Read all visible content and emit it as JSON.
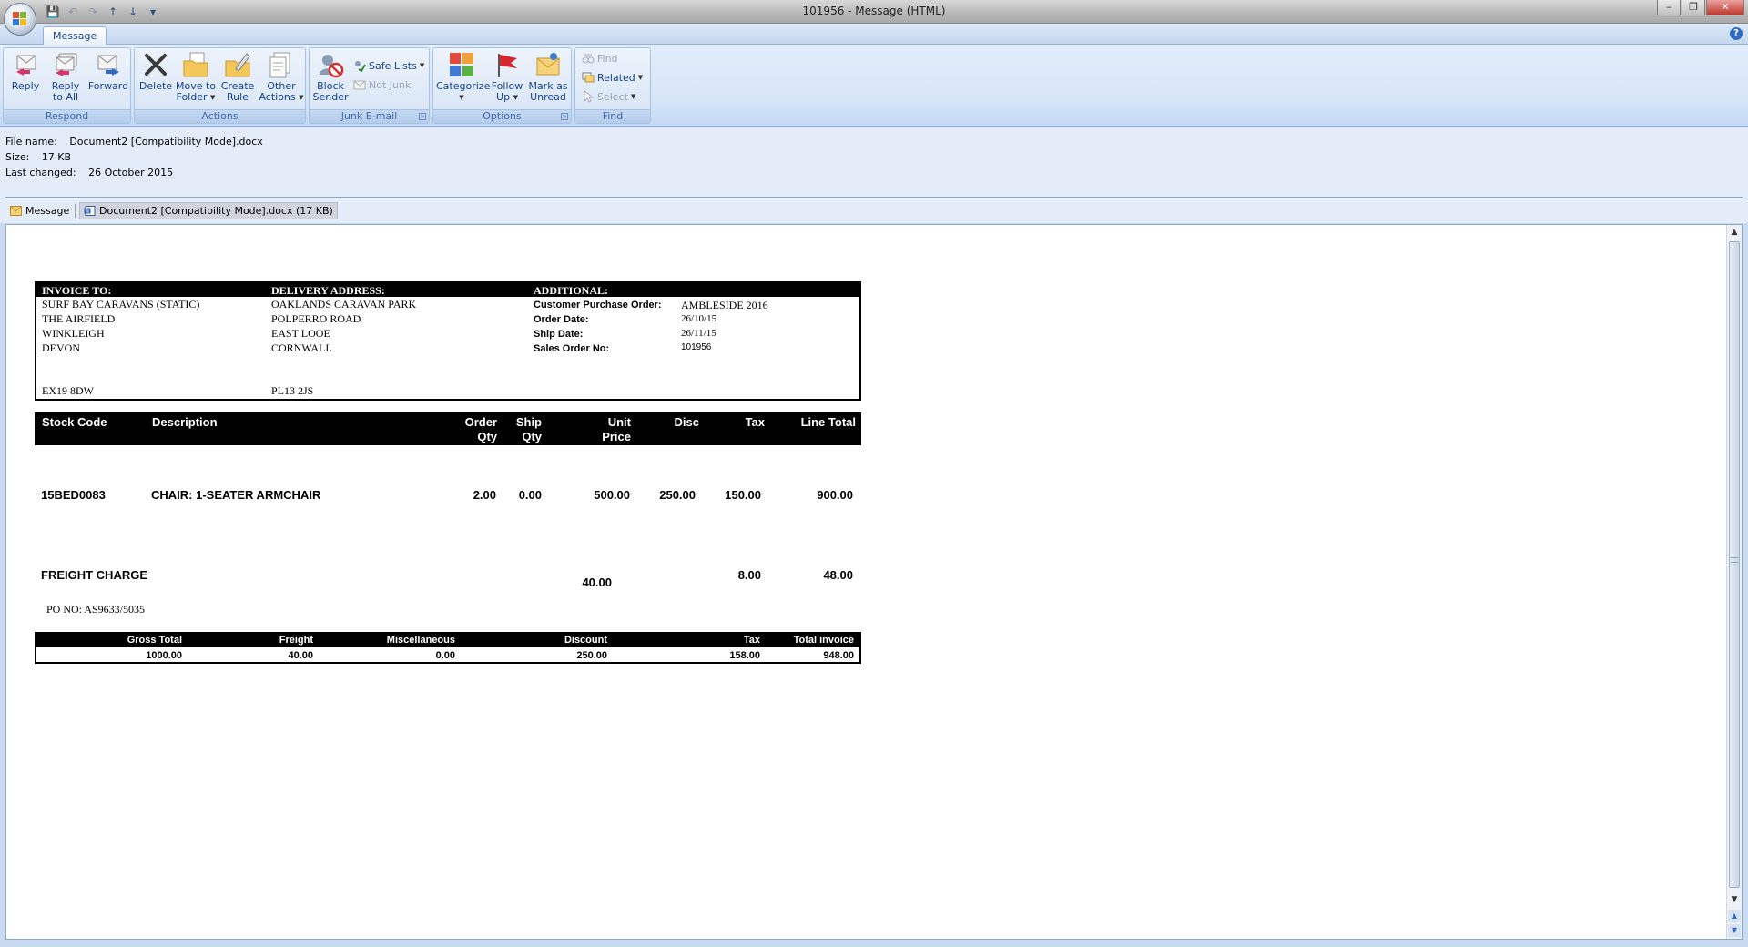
{
  "window": {
    "title": "101956 - Message (HTML)",
    "minimize": "–",
    "restore": "❐",
    "close": "✕"
  },
  "ribbon": {
    "tab": "Message",
    "groups": {
      "respond": {
        "label": "Respond",
        "reply": "Reply",
        "reply_all_1": "Reply",
        "reply_all_2": "to All",
        "forward": "Forward"
      },
      "actions": {
        "label": "Actions",
        "delete": "Delete",
        "move_1": "Move to",
        "move_2": "Folder",
        "create_1": "Create",
        "create_2": "Rule",
        "other_1": "Other",
        "other_2": "Actions"
      },
      "junk": {
        "label": "Junk E-mail",
        "block_1": "Block",
        "block_2": "Sender",
        "safe_lists": "Safe Lists",
        "not_junk": "Not Junk"
      },
      "options": {
        "label": "Options",
        "categorize": "Categorize",
        "follow_1": "Follow",
        "follow_2": "Up",
        "mark_1": "Mark as",
        "mark_2": "Unread"
      },
      "find": {
        "label": "Find",
        "find": "Find",
        "related": "Related",
        "select": "Select"
      }
    }
  },
  "attachment_info": {
    "file_name_label": "File name:",
    "file_name": "Document2 [Compatibility Mode].docx",
    "size_label": "Size:",
    "size": "17 KB",
    "last_changed_label": "Last changed:",
    "last_changed": "26 October 2015"
  },
  "attachments": {
    "message": "Message",
    "document": "Document2 [Compatibility Mode].docx (17 KB)"
  },
  "invoice": {
    "invoice_to": {
      "heading": "INVOICE TO:",
      "lines": [
        "SURF BAY CARAVANS (STATIC)",
        "THE AIRFIELD",
        "WINKLEIGH",
        "DEVON"
      ],
      "postcode": "EX19 8DW"
    },
    "delivery": {
      "heading": "DELIVERY ADDRESS:",
      "lines": [
        "OAKLANDS CARAVAN PARK",
        "POLPERRO ROAD",
        "EAST LOOE",
        "CORNWALL"
      ],
      "postcode": "PL13 2JS"
    },
    "additional": {
      "heading": "ADDITIONAL:",
      "rows": [
        {
          "label": "Customer Purchase Order:",
          "value": "AMBLESIDE 2016"
        },
        {
          "label": "Order Date:",
          "value": "26/10/15"
        },
        {
          "label": "Ship Date:",
          "value": "26/11/15"
        },
        {
          "label": "Sales Order No:",
          "value": "101956"
        }
      ]
    },
    "columns": {
      "stock_code": "Stock Code",
      "description": "Description",
      "order_qty_1": "Order",
      "order_qty_2": "Qty",
      "ship_qty_1": "Ship",
      "ship_qty_2": "Qty",
      "unit_price_1": "Unit",
      "unit_price_2": "Price",
      "disc": "Disc",
      "tax": "Tax",
      "line_total": "Line Total"
    },
    "item": {
      "stock_code": "15BED0083",
      "description": "CHAIR: 1-SEATER ARMCHAIR",
      "order_qty": "2.00",
      "ship_qty": "0.00",
      "unit_price": "500.00",
      "disc": "250.00",
      "tax": "150.00",
      "line_total": "900.00"
    },
    "freight": {
      "label": "FREIGHT CHARGE",
      "price": "40.00",
      "tax": "8.00",
      "line_total": "48.00"
    },
    "po_no": "PO NO: AS9633/5035",
    "totals": {
      "headers": [
        "Gross Total",
        "Freight",
        "Miscellaneous",
        "Discount",
        "Tax",
        "Total invoice"
      ],
      "values": [
        "1000.00",
        "40.00",
        "0.00",
        "250.00",
        "158.00",
        "948.00"
      ]
    }
  }
}
